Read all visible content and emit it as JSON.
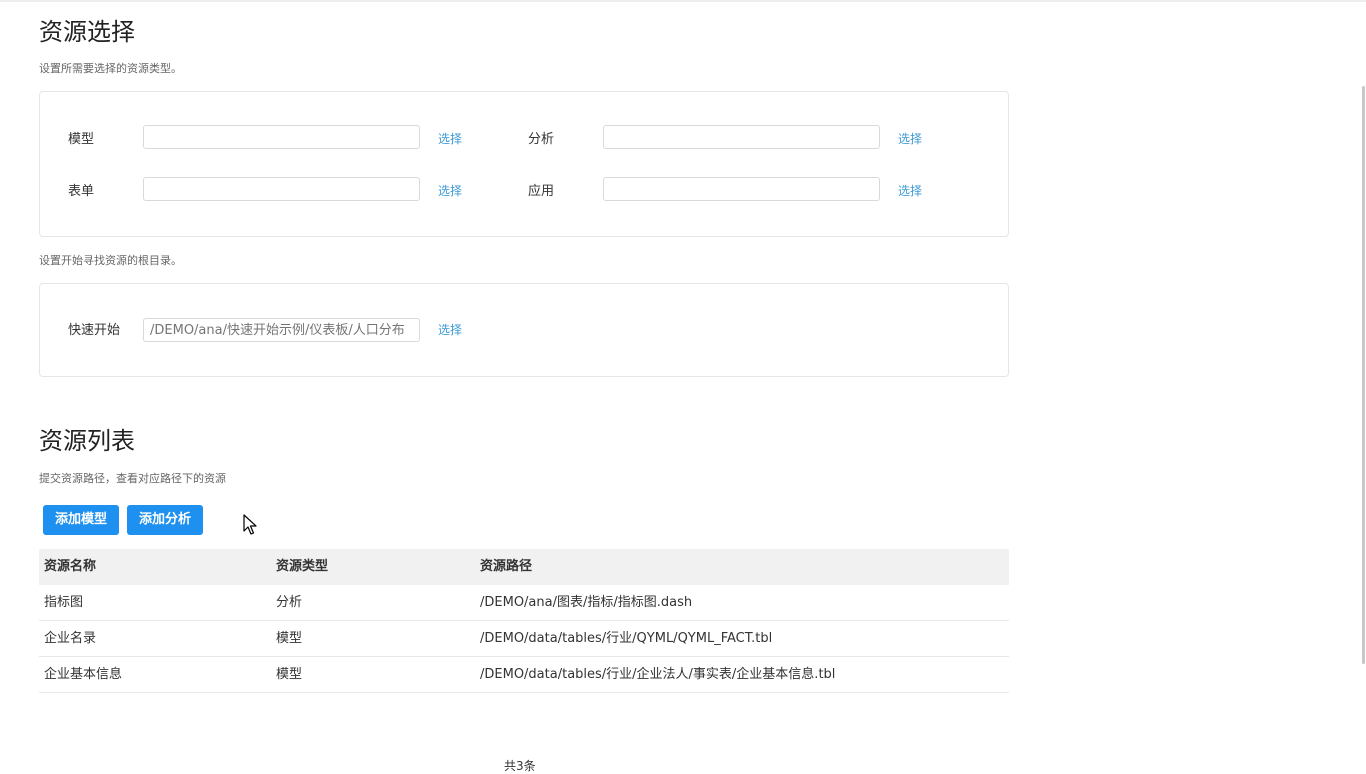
{
  "section1": {
    "title": "资源选择",
    "desc": "设置所需要选择的资源类型。",
    "fields": {
      "model": {
        "label": "模型",
        "value": "",
        "pick": "选择"
      },
      "analysis": {
        "label": "分析",
        "value": "",
        "pick": "选择"
      },
      "form": {
        "label": "表单",
        "value": "",
        "pick": "选择"
      },
      "app": {
        "label": "应用",
        "value": "",
        "pick": "选择"
      }
    },
    "root_desc": "设置开始寻找资源的根目录。",
    "quickstart": {
      "label": "快速开始",
      "placeholder": "/DEMO/ana/快速开始示例/仪表板/人口分布",
      "pick": "选择"
    }
  },
  "section2": {
    "title": "资源列表",
    "desc": "提交资源路径，查看对应路径下的资源",
    "add_model": "添加模型",
    "add_analysis": "添加分析",
    "columns": [
      "资源名称",
      "资源类型",
      "资源路径"
    ],
    "rows": [
      [
        "指标图",
        "分析",
        "/DEMO/ana/图表/指标/指标图.dash"
      ],
      [
        "企业名录",
        "模型",
        "/DEMO/data/tables/行业/QYML/QYML_FACT.tbl"
      ],
      [
        "企业基本信息",
        "模型",
        "/DEMO/data/tables/行业/企业法人/事实表/企业基本信息.tbl"
      ]
    ],
    "total": "共3条"
  },
  "colors": {
    "accent": "#1e90ef",
    "link": "#3d9bd8",
    "header_bg": "#f1f1f1"
  },
  "icons": {
    "cursor": "mouse-pointer-icon"
  }
}
